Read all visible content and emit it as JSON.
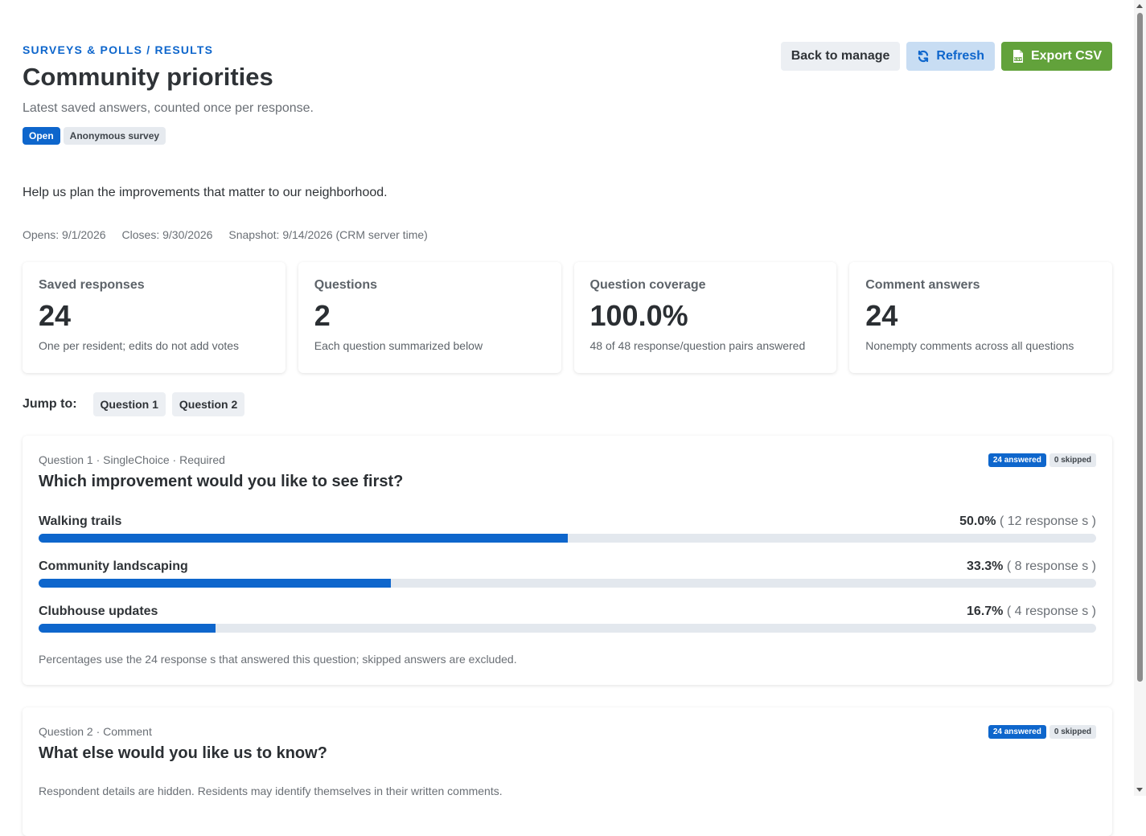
{
  "header": {
    "breadcrumb": "SURVEYS & POLLS / RESULTS",
    "title": "Community priorities",
    "subtitle": "Latest saved answers, counted once per response.",
    "badges": {
      "status": "Open",
      "mode": "Anonymous survey"
    }
  },
  "actions": {
    "back_label": "Back to manage",
    "refresh_label": "Refresh",
    "export_label": "Export CSV",
    "icons": {
      "refresh": "refresh-icon",
      "export": "csv-file-icon"
    }
  },
  "description": "Help us plan the improvements that matter to our neighborhood.",
  "dates": {
    "opens": "Opens: 9/1/2026",
    "closes": "Closes: 9/30/2026",
    "snapshot": "Snapshot: 9/14/2026 (CRM server time)"
  },
  "stats": [
    {
      "label": "Saved responses",
      "value": "24",
      "note": "One per resident; edits do not add votes"
    },
    {
      "label": "Questions",
      "value": "2",
      "note": "Each question summarized below"
    },
    {
      "label": "Question coverage",
      "value": "100.0%",
      "note": "48 of 48 response/question pairs answered"
    },
    {
      "label": "Comment answers",
      "value": "24",
      "note": "Nonempty comments across all questions"
    }
  ],
  "jump": {
    "label": "Jump to:",
    "links": [
      "Question 1",
      "Question 2"
    ]
  },
  "questions": [
    {
      "meta": "Question 1 · SingleChoice · Required",
      "title": "Which improvement would you like to see first?",
      "answered": "24 answered",
      "skipped": "0 skipped",
      "options": [
        {
          "label": "Walking trails",
          "pct": "50.0%",
          "count": " ( 12 response s )",
          "fraction": 0.5
        },
        {
          "label": "Community landscaping",
          "pct": "33.3%",
          "count": " ( 8 response s )",
          "fraction": 0.333
        },
        {
          "label": "Clubhouse updates",
          "pct": "16.7%",
          "count": " ( 4 response s )",
          "fraction": 0.167
        }
      ],
      "footnote": "Percentages use the 24 response s that answered this question; skipped answers are excluded."
    },
    {
      "meta": "Question 2 · Comment",
      "title": "What else would you like us to know?",
      "answered": "24 answered",
      "skipped": "0 skipped",
      "note": "Respondent details are hidden. Residents may identify themselves in their written comments."
    }
  ],
  "colors": {
    "accent": "#0e66cc",
    "export": "#62a23b",
    "refresh_bg": "#c8ddf3",
    "track": "#e3e8ee"
  }
}
